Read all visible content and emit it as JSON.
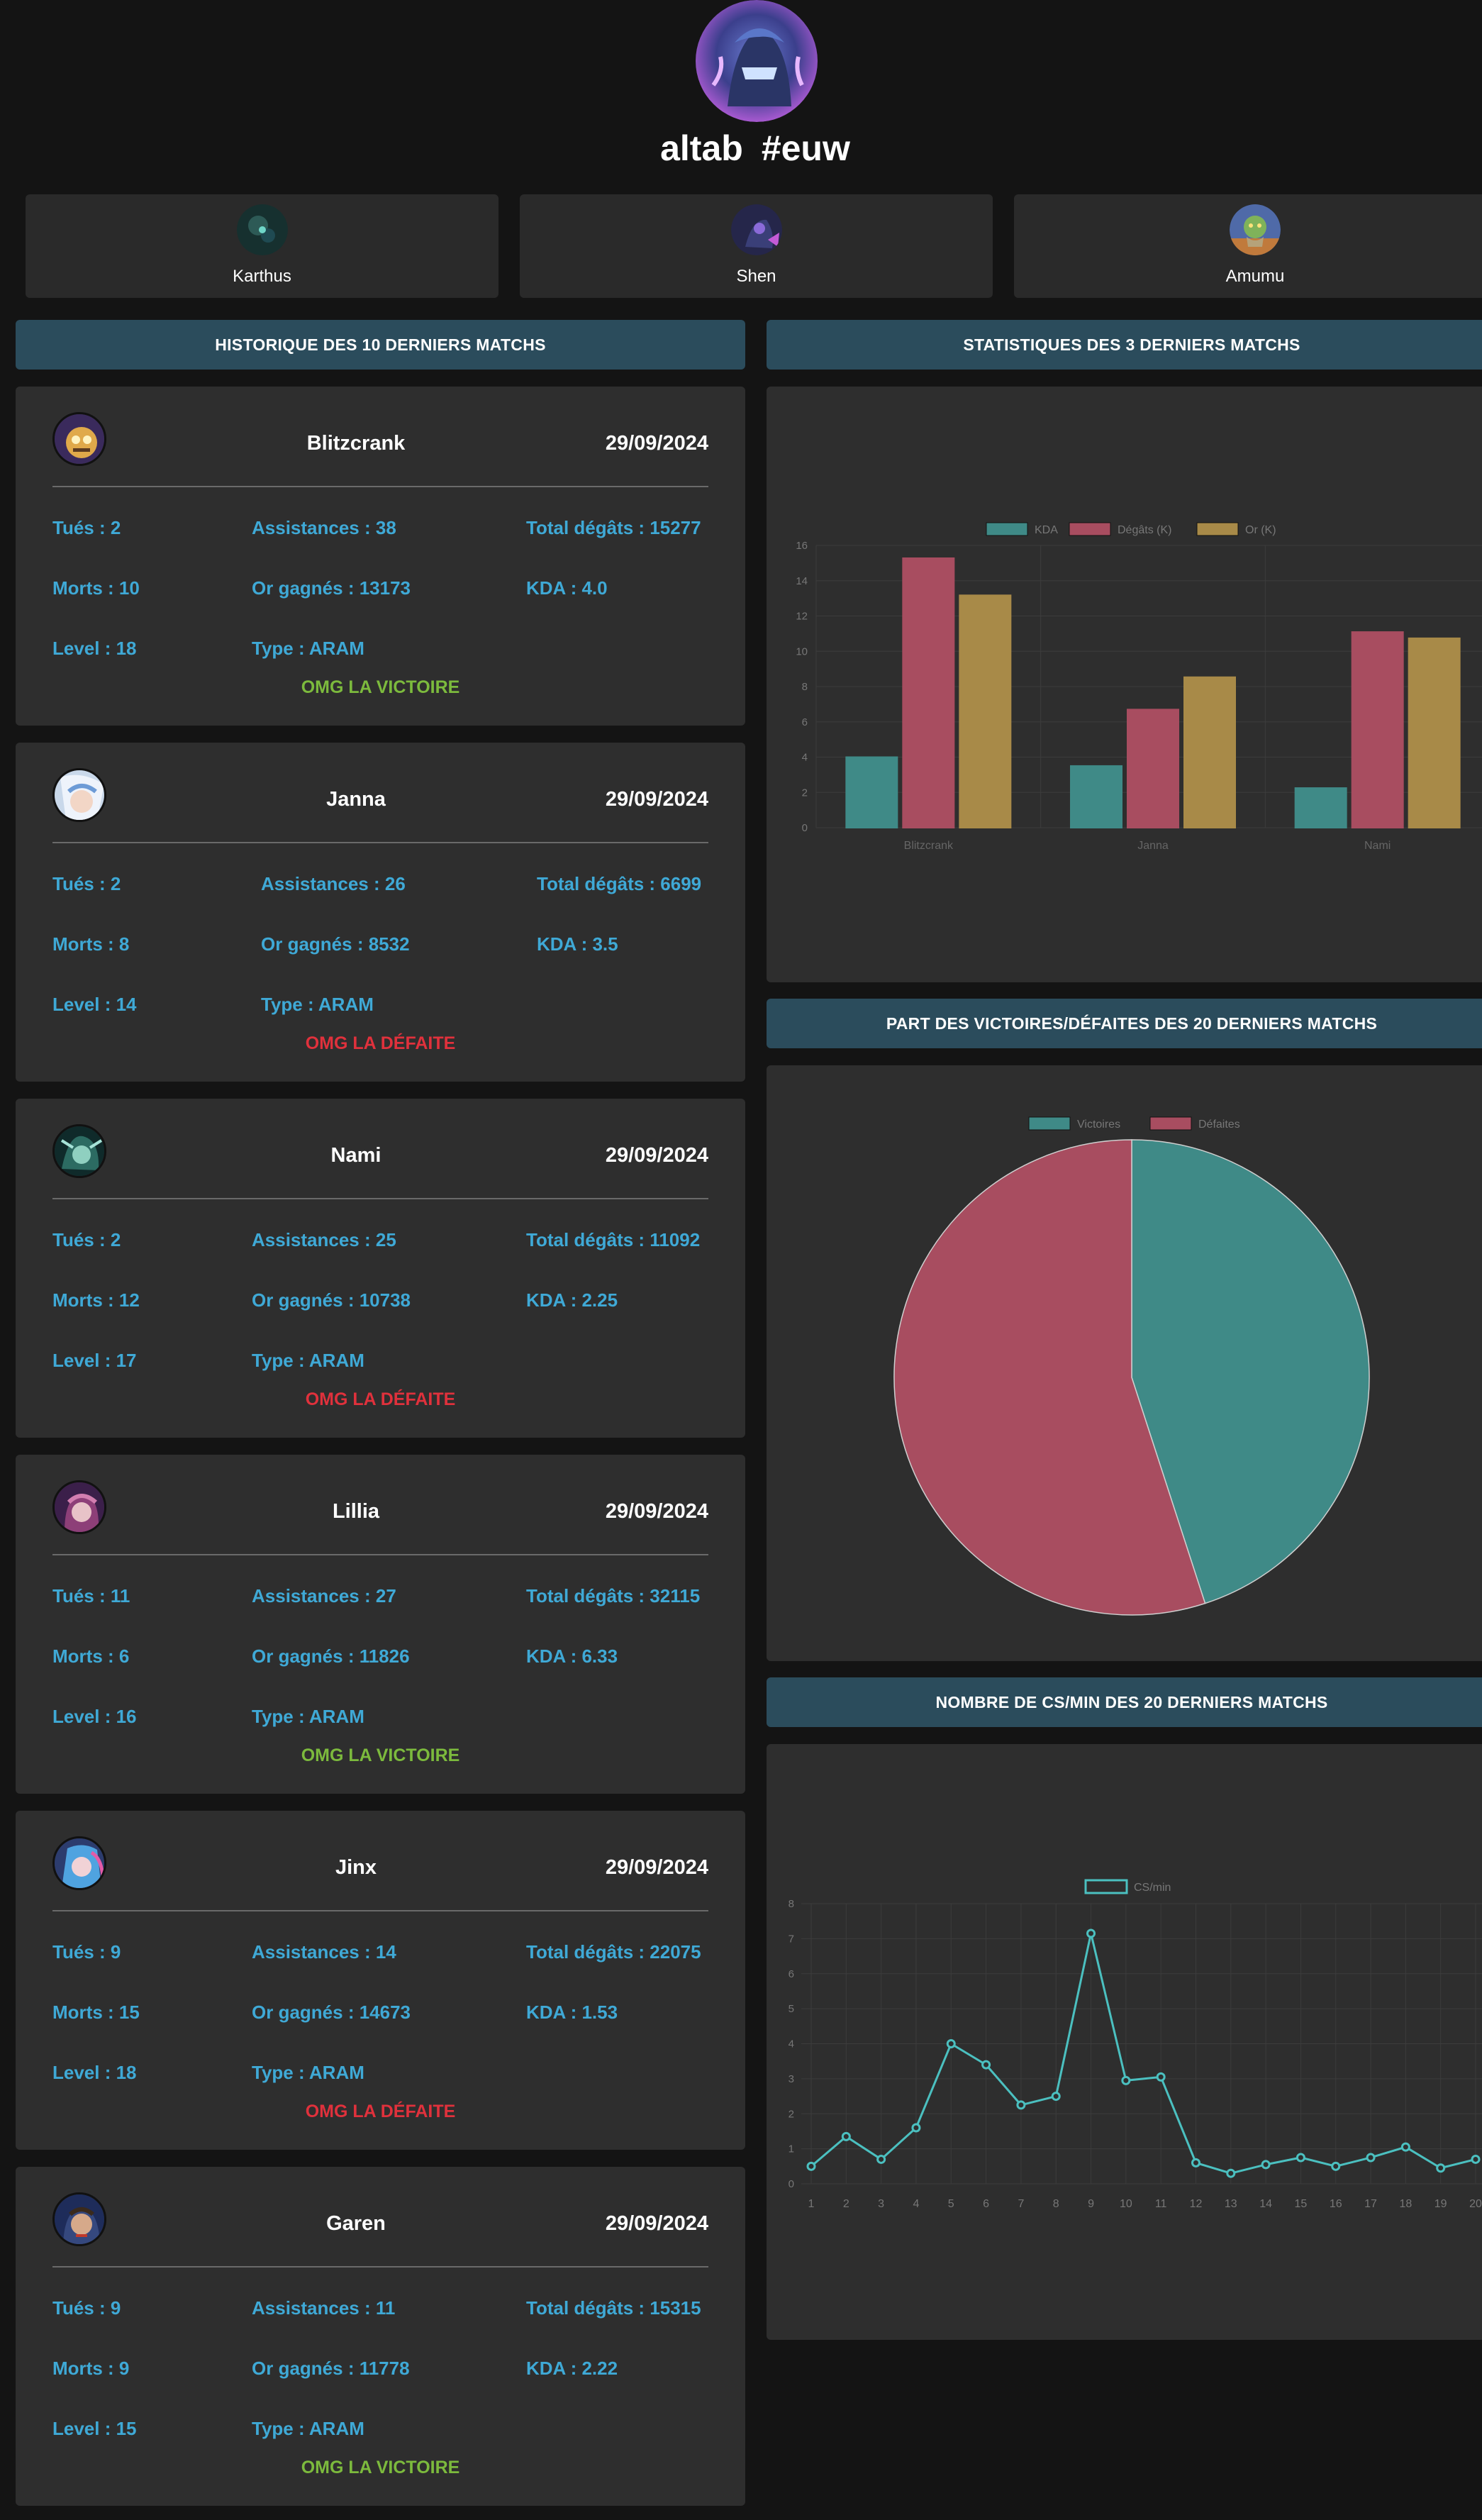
{
  "profile": {
    "name": "altab",
    "tag": "#euw",
    "avatar": "summoner-avatar"
  },
  "top_champions": [
    {
      "name": "Karthus",
      "icon": "karthus-icon"
    },
    {
      "name": "Shen",
      "icon": "shen-icon"
    },
    {
      "name": "Amumu",
      "icon": "amumu-icon"
    }
  ],
  "sections": {
    "history_title": "HISTORIQUE DES 10 DERNIERS MATCHS",
    "stats_title": "STATISTIQUES DES 3 DERNIERS MATCHS",
    "winloss_title": "PART DES VICTOIRES/DÉFAITES DES 20 DERNIERS MATCHS",
    "cs_title": "NOMBRE DE CS/MIN DES 20 DERNIERS MATCHS"
  },
  "matches": [
    {
      "champion": "Blitzcrank",
      "date": "29/09/2024",
      "kills": "Tués : 2",
      "assists": "Assistances : 38",
      "damage": "Total dégâts : 15277",
      "deaths": "Morts : 10",
      "gold": "Or gagnés : 13173",
      "kda": "KDA : 4.0",
      "level": "Level : 18",
      "type": "Type : ARAM",
      "result": "OMG LA VICTOIRE",
      "win": true
    },
    {
      "champion": "Janna",
      "date": "29/09/2024",
      "kills": "Tués : 2",
      "assists": "Assistances : 26",
      "damage": "Total dégâts : 6699",
      "deaths": "Morts : 8",
      "gold": "Or gagnés : 8532",
      "kda": "KDA : 3.5",
      "level": "Level : 14",
      "type": "Type : ARAM",
      "result": "OMG LA DÉFAITE",
      "win": false
    },
    {
      "champion": "Nami",
      "date": "29/09/2024",
      "kills": "Tués : 2",
      "assists": "Assistances : 25",
      "damage": "Total dégâts : 11092",
      "deaths": "Morts : 12",
      "gold": "Or gagnés : 10738",
      "kda": "KDA : 2.25",
      "level": "Level : 17",
      "type": "Type : ARAM",
      "result": "OMG LA DÉFAITE",
      "win": false
    },
    {
      "champion": "Lillia",
      "date": "29/09/2024",
      "kills": "Tués : 11",
      "assists": "Assistances : 27",
      "damage": "Total dégâts : 32115",
      "deaths": "Morts : 6",
      "gold": "Or gagnés : 11826",
      "kda": "KDA : 6.33",
      "level": "Level : 16",
      "type": "Type : ARAM",
      "result": "OMG LA VICTOIRE",
      "win": true
    },
    {
      "champion": "Jinx",
      "date": "29/09/2024",
      "kills": "Tués : 9",
      "assists": "Assistances : 14",
      "damage": "Total dégâts : 22075",
      "deaths": "Morts : 15",
      "gold": "Or gagnés : 14673",
      "kda": "KDA : 1.53",
      "level": "Level : 18",
      "type": "Type : ARAM",
      "result": "OMG LA DÉFAITE",
      "win": false
    },
    {
      "champion": "Garen",
      "date": "29/09/2024",
      "kills": "Tués : 9",
      "assists": "Assistances : 11",
      "damage": "Total dégâts : 15315",
      "deaths": "Morts : 9",
      "gold": "Or gagnés : 11778",
      "kda": "KDA : 2.22",
      "level": "Level : 15",
      "type": "Type : ARAM",
      "result": "OMG LA VICTOIRE",
      "win": true
    }
  ],
  "colors": {
    "teal": "#3f8a87",
    "teal_line": "#4bc0c0",
    "red": "#a84d60",
    "gold": "#a88a48",
    "win_text": "#7cba3d",
    "loss_text": "#e0313c",
    "stat_text": "#3fa9d6",
    "header_bg": "#2b4c5c"
  },
  "chart_data": [
    {
      "type": "bar",
      "categories": [
        "Blitzcrank",
        "Janna",
        "Nami"
      ],
      "series": [
        {
          "name": "KDA",
          "values": [
            4.0,
            3.5,
            2.25
          ]
        },
        {
          "name": "Dégâts (K)",
          "values": [
            15.277,
            6.699,
            11.092
          ]
        },
        {
          "name": "Or (K)",
          "values": [
            13.173,
            8.532,
            10.738
          ]
        }
      ],
      "ylim": [
        0,
        16
      ],
      "yticks": [
        0,
        2,
        4,
        6,
        8,
        10,
        12,
        14,
        16
      ],
      "legend": "top-center",
      "grid": true
    },
    {
      "type": "pie",
      "labels": [
        "Victoires",
        "Défaites"
      ],
      "values": [
        9,
        11
      ],
      "legend": "top-center"
    },
    {
      "type": "line",
      "series": [
        {
          "name": "CS/min",
          "values": [
            0.5,
            1.35,
            0.7,
            1.6,
            4.0,
            3.4,
            2.25,
            2.5,
            7.15,
            2.95,
            3.05,
            0.6,
            0.3,
            0.55,
            0.75,
            0.5,
            0.75,
            1.05,
            0.45,
            0.7
          ]
        }
      ],
      "x": [
        "1",
        "2",
        "3",
        "4",
        "5",
        "6",
        "7",
        "8",
        "9",
        "10",
        "11",
        "12",
        "13",
        "14",
        "15",
        "16",
        "17",
        "18",
        "19",
        "20"
      ],
      "ylim": [
        0,
        8
      ],
      "yticks": [
        0,
        1,
        2,
        3,
        4,
        5,
        6,
        7,
        8
      ],
      "legend": "top-center",
      "grid": true
    }
  ]
}
